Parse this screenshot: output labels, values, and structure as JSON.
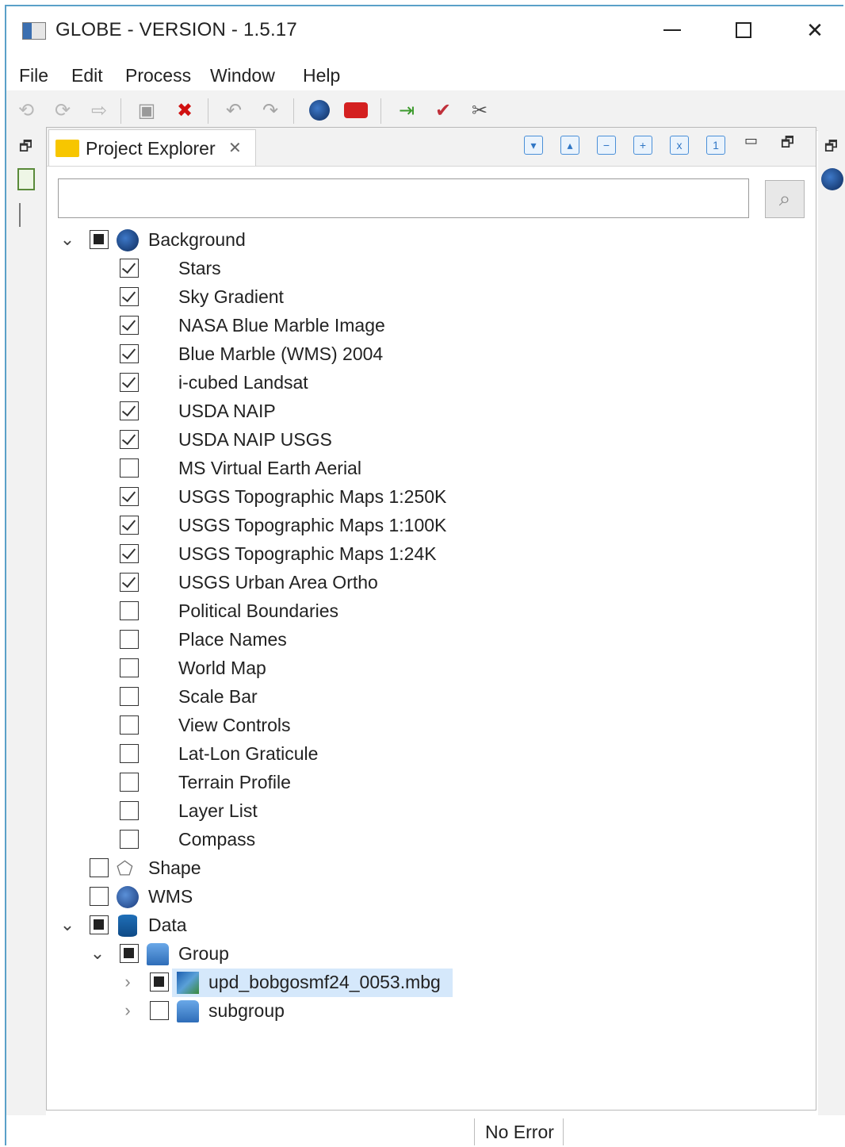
{
  "window": {
    "title": "GLOBE - VERSION - 1.5.17"
  },
  "menu": [
    "File",
    "Edit",
    "Process",
    "Window",
    "Help"
  ],
  "toolbar": {
    "icons": [
      "undo-icon",
      "redo-icon",
      "forward-icon",
      "save-icon",
      "delete-icon",
      "refresh-icon",
      "redo-action-icon",
      "globe-icon",
      "toolbox-icon",
      "import-icon",
      "export-icon",
      "tools-icon"
    ]
  },
  "panel": {
    "tab_label": "Project Explorer",
    "tab_close": "✕",
    "search": {
      "value": "",
      "placeholder": ""
    }
  },
  "tree": {
    "background": {
      "label": "Background",
      "state": "partial",
      "expanded": true,
      "items": [
        {
          "label": "Stars",
          "checked": true
        },
        {
          "label": "Sky Gradient",
          "checked": true
        },
        {
          "label": "NASA Blue Marble Image",
          "checked": true
        },
        {
          "label": "Blue Marble (WMS) 2004",
          "checked": true
        },
        {
          "label": "i-cubed Landsat",
          "checked": true
        },
        {
          "label": "USDA NAIP",
          "checked": true
        },
        {
          "label": "USDA NAIP USGS",
          "checked": true
        },
        {
          "label": "MS Virtual Earth Aerial",
          "checked": false
        },
        {
          "label": "USGS Topographic Maps 1:250K",
          "checked": true
        },
        {
          "label": "USGS Topographic Maps 1:100K",
          "checked": true
        },
        {
          "label": "USGS Topographic Maps 1:24K",
          "checked": true
        },
        {
          "label": "USGS Urban Area Ortho",
          "checked": true
        },
        {
          "label": "Political Boundaries",
          "checked": false
        },
        {
          "label": "Place Names",
          "checked": false
        },
        {
          "label": "World Map",
          "checked": false
        },
        {
          "label": "Scale Bar",
          "checked": false
        },
        {
          "label": "View Controls",
          "checked": false
        },
        {
          "label": "Lat-Lon Graticule",
          "checked": false
        },
        {
          "label": "Terrain Profile",
          "checked": false
        },
        {
          "label": "Layer List",
          "checked": false
        },
        {
          "label": "Compass",
          "checked": false
        }
      ]
    },
    "shape": {
      "label": "Shape",
      "checked": false
    },
    "wms": {
      "label": "WMS",
      "checked": false
    },
    "data": {
      "label": "Data",
      "state": "partial",
      "expanded": true,
      "group": {
        "label": "Group",
        "state": "partial",
        "expanded": true,
        "file": {
          "label": "upd_bobgosmf24_0053.mbg",
          "state": "partial",
          "selected": true
        },
        "subgroup": {
          "label": "subgroup",
          "checked": false
        }
      }
    }
  },
  "status": {
    "text": "No Error"
  }
}
